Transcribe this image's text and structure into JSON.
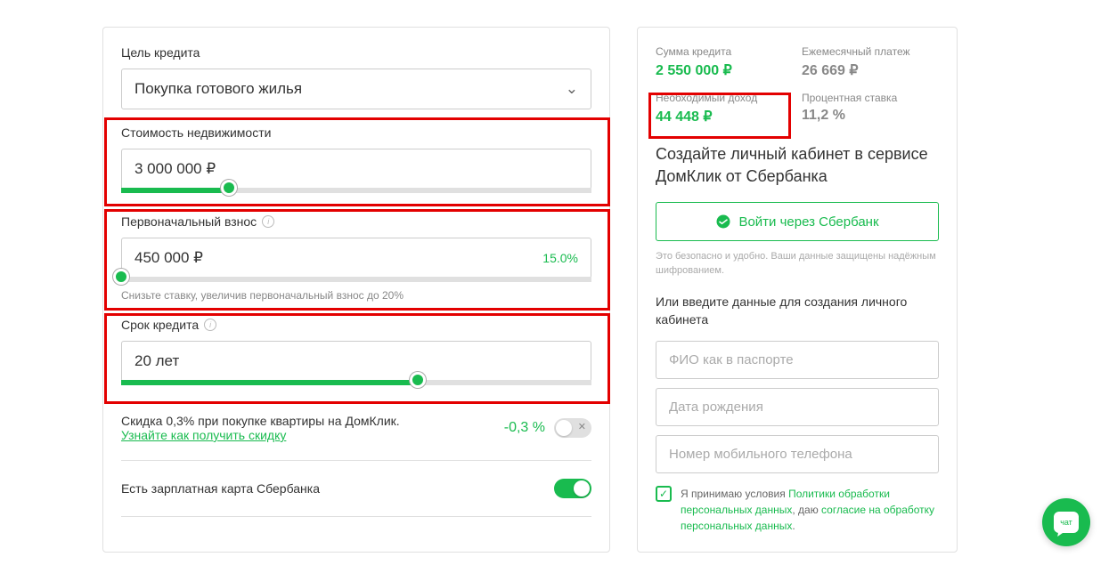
{
  "form": {
    "purpose": {
      "label": "Цель кредита",
      "value": "Покупка готового жилья"
    },
    "property": {
      "label": "Стоимость недвижимости",
      "value": "3 000 000 ₽",
      "slider_pct": 23
    },
    "downpayment": {
      "label": "Первоначальный взнос",
      "value": "450 000 ₽",
      "pct": "15.0%",
      "hint": "Снизьте ставку, увеличив первоначальный взнос до 20%",
      "slider_pct": 0
    },
    "term": {
      "label": "Срок кредита",
      "value": "20 лет",
      "slider_pct": 63
    },
    "discount": {
      "text1": "Скидка 0,3% при покупке квартиры на ДомКлик.",
      "link": "Узнайте как получить скидку",
      "pct": "-0,3 %"
    },
    "salary_card": {
      "label": "Есть зарплатная карта Сбербанка"
    }
  },
  "summary": {
    "loan_amount": {
      "label": "Сумма кредита",
      "value": "2 550 000 ₽"
    },
    "monthly": {
      "label": "Ежемесячный платеж",
      "value": "26 669 ₽"
    },
    "income": {
      "label": "Необходимый доход",
      "value": "44 448 ₽"
    },
    "rate": {
      "label": "Процентная ставка",
      "value": "11,2 %"
    }
  },
  "right": {
    "heading": "Создайте личный кабинет в сервисе ДомКлик от Сбербанка",
    "sber_btn": "Войти через Сбербанк",
    "safe": "Это безопасно и удобно. Ваши данные защищены надёжным шифрованием.",
    "or": "Или введите данные для создания личного кабинета",
    "fio_ph": "ФИО как в паспорте",
    "dob_ph": "Дата рождения",
    "phone_ph": "Номер мобильного телефона",
    "consent_1": "Я принимаю условия ",
    "consent_link1": "Политики обработки персональных данных",
    "consent_2": ", даю ",
    "consent_link2": "согласие на обработку персональных данных",
    "consent_3": "."
  },
  "chat": {
    "label": "чат"
  }
}
